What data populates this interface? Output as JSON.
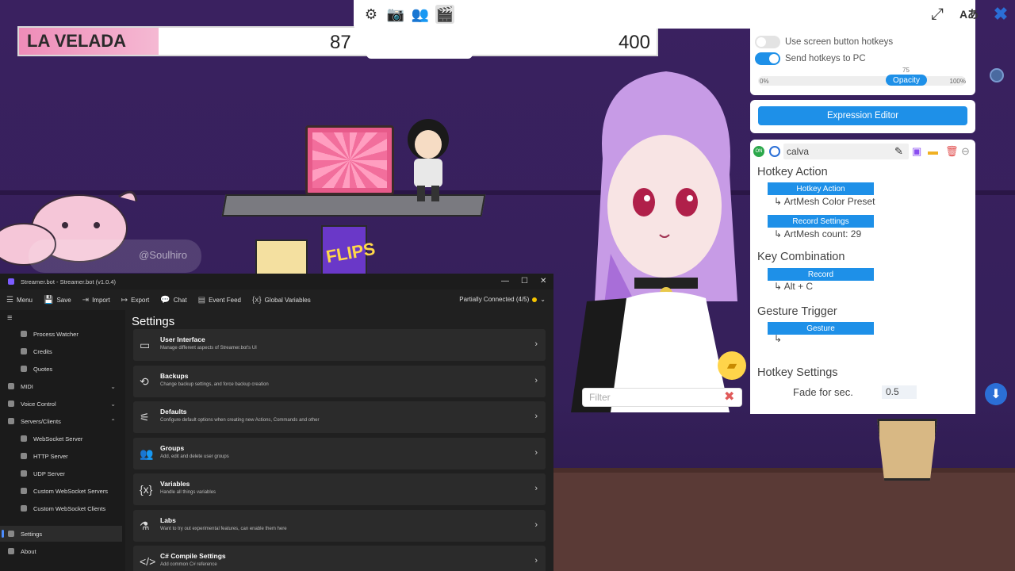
{
  "scoreboard": {
    "name": "LA VELADA",
    "value1": "87",
    "value2": "400"
  },
  "scene": {
    "box_text": "FLIPS",
    "tag_text": "@Soulhiro"
  },
  "topbar": {
    "icons": [
      "gear-icon",
      "camera-icon",
      "user-settings-icon",
      "clapperboard-icon"
    ],
    "glyphs": {
      "gear": "⚙",
      "camera": "📷",
      "users": "👥",
      "scene": "🎬",
      "expand": "⤢",
      "translate": "Aあ",
      "close": "✖"
    }
  },
  "vts": {
    "toggle1_label": "Use screen button hotkeys",
    "toggle2_label": "Send hotkeys to PC",
    "opacity_value": "75",
    "opacity_label": "Opacity",
    "opacity_min": "0%",
    "opacity_max": "100%",
    "expression_editor": "Expression Editor",
    "hotkey_name": "calva",
    "on_label": "ON",
    "hotkey_action_h": "Hotkey Action",
    "hotkey_action_btn": "Hotkey Action",
    "action_value": "ArtMesh Color Preset",
    "record_settings_btn": "Record Settings",
    "artmesh_count": "ArtMesh count: 29",
    "key_combo_h": "Key Combination",
    "record_btn": "Record",
    "key_combo_value": "Alt + C",
    "gesture_h": "Gesture Trigger",
    "gesture_btn": "Gesture",
    "hotkey_settings_h": "Hotkey Settings",
    "fade_label": "Fade for sec.",
    "fade_value": "0.5",
    "filter_placeholder": "Filter",
    "arrow_glyph": "↳"
  },
  "streamerbot": {
    "title": "Streamer.bot - Streamer.bot (v1.0.4)",
    "menu": [
      {
        "icon": "☰",
        "label": "Menu"
      },
      {
        "icon": "💾",
        "label": "Save"
      },
      {
        "icon": "⇥",
        "label": "Import"
      },
      {
        "icon": "↦",
        "label": "Export"
      },
      {
        "icon": "💬",
        "label": "Chat"
      },
      {
        "icon": "▤",
        "label": "Event Feed"
      },
      {
        "icon": "{x}",
        "label": "Global Variables"
      }
    ],
    "connection": "Partially Connected (4/5)",
    "sidebar": [
      {
        "label": "Process Watcher",
        "kind": "sub"
      },
      {
        "label": "Credits",
        "kind": "sub"
      },
      {
        "label": "Quotes",
        "kind": "sub"
      },
      {
        "label": "MIDI",
        "kind": "top"
      },
      {
        "label": "Voice Control",
        "kind": "top"
      },
      {
        "label": "Servers/Clients",
        "kind": "top"
      },
      {
        "label": "WebSocket Server",
        "kind": "sub"
      },
      {
        "label": "HTTP Server",
        "kind": "sub"
      },
      {
        "label": "UDP Server",
        "kind": "sub"
      },
      {
        "label": "Custom WebSocket Servers",
        "kind": "sub"
      },
      {
        "label": "Custom WebSocket Clients",
        "kind": "sub"
      },
      {
        "label": "Settings",
        "kind": "top"
      },
      {
        "label": "About",
        "kind": "top"
      }
    ],
    "settings_title": "Settings",
    "cards": [
      {
        "icon": "▭",
        "title": "User Interface",
        "desc": "Manage different aspects of Streamer.bot's UI"
      },
      {
        "icon": "⟲",
        "title": "Backups",
        "desc": "Change backup settings, and force backup creation"
      },
      {
        "icon": "⚟",
        "title": "Defaults",
        "desc": "Configure default options when creating new Actions, Commands and other"
      },
      {
        "icon": "👥",
        "title": "Groups",
        "desc": "Add, edit and delete user groups"
      },
      {
        "icon": "{x}",
        "title": "Variables",
        "desc": "Handle all things variables"
      },
      {
        "icon": "⚗",
        "title": "Labs",
        "desc": "Want to try out experimental features, can enable them here"
      },
      {
        "icon": "</>",
        "title": "C# Compile Settings",
        "desc": "Add common C# reference"
      }
    ]
  }
}
